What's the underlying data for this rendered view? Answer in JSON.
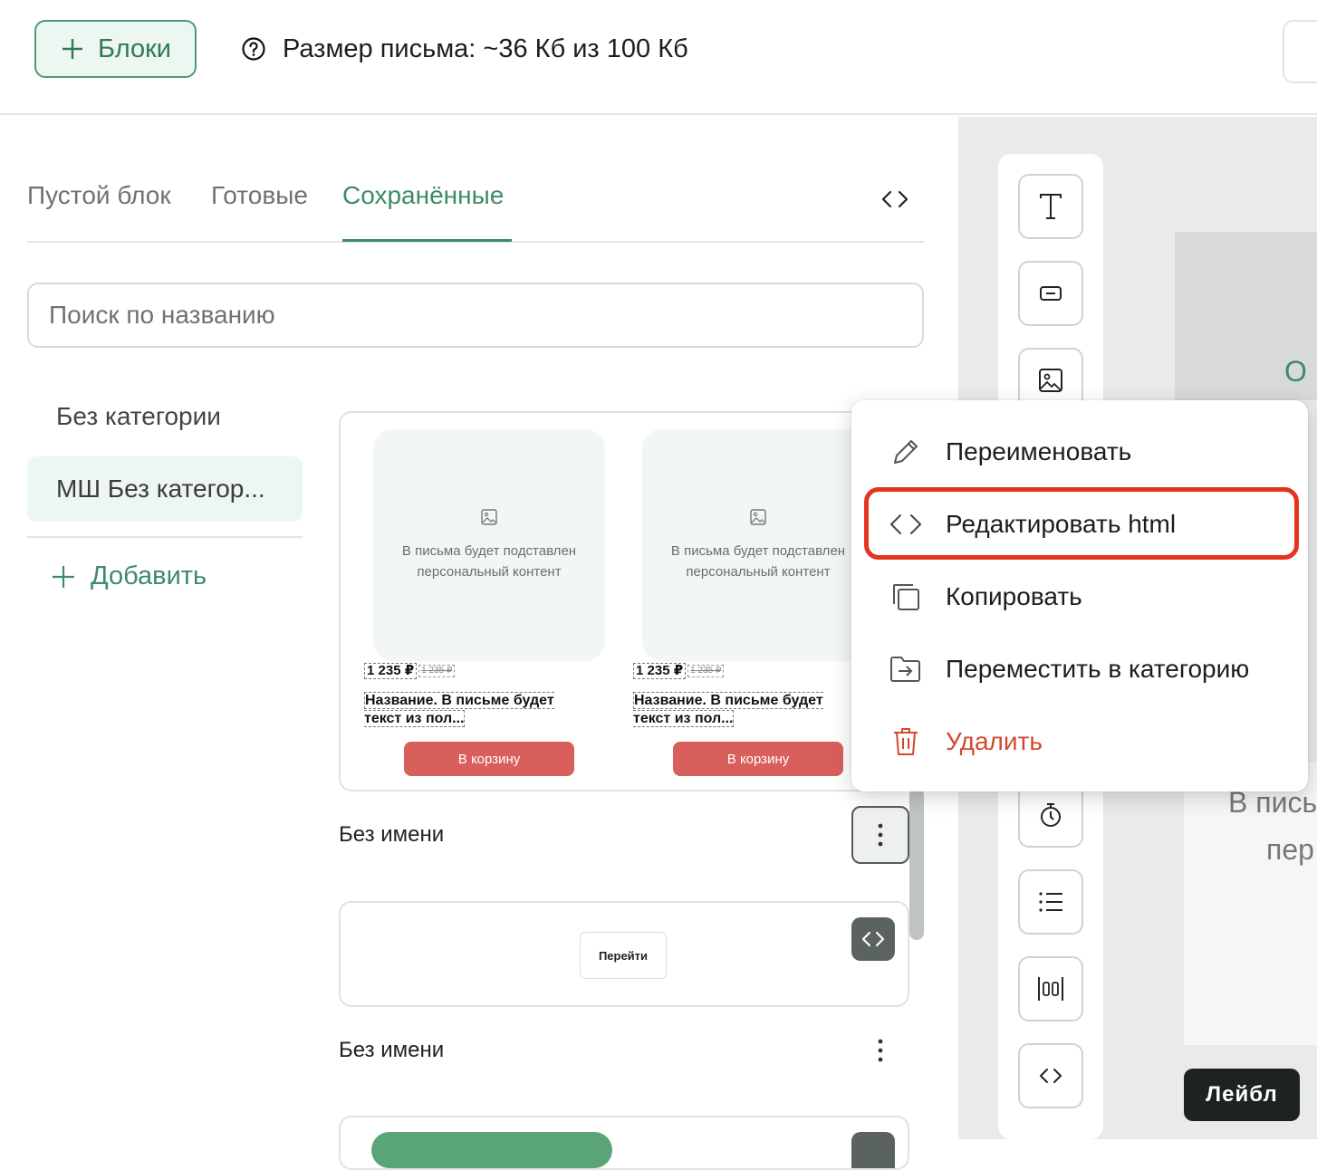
{
  "header": {
    "blocks_button_label": "Блоки",
    "size_info_label": "Размер письма: ~36 Кб из 100 Кб"
  },
  "tabs": [
    {
      "label": "Пустой блок",
      "active": false
    },
    {
      "label": "Готовые",
      "active": false
    },
    {
      "label": "Сохранённые",
      "active": true
    }
  ],
  "search": {
    "placeholder": "Поиск по названию",
    "value": ""
  },
  "categories": {
    "items": [
      {
        "label": "Без категории",
        "selected": false
      },
      {
        "label": "МШ Без категор...",
        "selected": true
      }
    ],
    "add_label": "Добавить"
  },
  "blocks": [
    {
      "title": "Без имени",
      "products": [
        {
          "placeholder": "В письма будет подставлен персональный контент",
          "price": "1 235 ₽",
          "old_price": "1 235 ₽",
          "name": "Название. В письме будет текст из пол...",
          "button": "В корзину"
        },
        {
          "placeholder": "В письма будет подставлен персональный контент",
          "price": "1 235 ₽",
          "old_price": "1 235 ₽",
          "name": "Название. В письме будет текст из пол...",
          "button": "В корзину"
        }
      ]
    },
    {
      "title": "Без имени",
      "button": "Перейти"
    }
  ],
  "context_menu": {
    "items": [
      {
        "label": "Переименовать",
        "icon": "pencil-icon"
      },
      {
        "label": "Редактировать html",
        "icon": "code-icon",
        "highlighted": true
      },
      {
        "label": "Копировать",
        "icon": "copy-icon"
      },
      {
        "label": "Переместить в категорию",
        "icon": "folder-move-icon"
      },
      {
        "label": "Удалить",
        "icon": "trash-icon",
        "danger": true
      }
    ]
  },
  "toolbar": {
    "tools": [
      "text-icon",
      "button-icon",
      "image-icon",
      "timer-icon",
      "list-icon",
      "columns-icon",
      "code-icon"
    ]
  },
  "preview": {
    "letter_o": "О",
    "text_line1": "В пись",
    "text_line2": "пер",
    "label_chip": "Лейбл"
  },
  "colors": {
    "accent": "#3d8b67",
    "danger": "#d2492c",
    "highlight": "#e5341e",
    "cart_button": "#d95f5c"
  }
}
